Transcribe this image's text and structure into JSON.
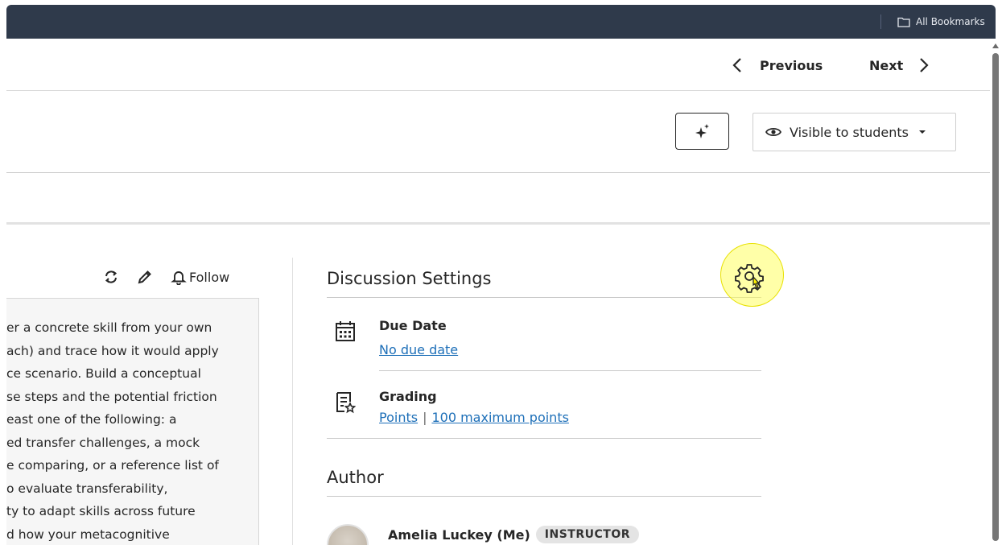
{
  "bookmarks": {
    "all_label": "All Bookmarks"
  },
  "nav": {
    "previous": "Previous",
    "next": "Next"
  },
  "toolbar": {
    "visibility_label": "Visible to students"
  },
  "discussion": {
    "follow_label": "Follow",
    "description_lines": [
      "er a concrete skill from your own",
      "ach) and trace how it would apply",
      "ce scenario. Build a conceptual",
      "se steps and the potential friction",
      "east one of the following: a",
      "ed transfer challenges, a mock",
      "e comparing, or a reference list of",
      "o evaluate transferability,",
      "ty to adapt skills across future",
      "d how your metacognitive"
    ]
  },
  "settings": {
    "title": "Discussion Settings",
    "due_date": {
      "label": "Due Date",
      "value": "No due date"
    },
    "grading": {
      "label": "Grading",
      "type": "Points",
      "separator": "|",
      "max": "100 maximum points"
    }
  },
  "author": {
    "title": "Author",
    "name": "Amelia Luckey (Me)",
    "role": "INSTRUCTOR"
  },
  "colors": {
    "topbar": "#2f3a4b",
    "link": "#1d6fb8",
    "highlight": "#ffff60"
  }
}
